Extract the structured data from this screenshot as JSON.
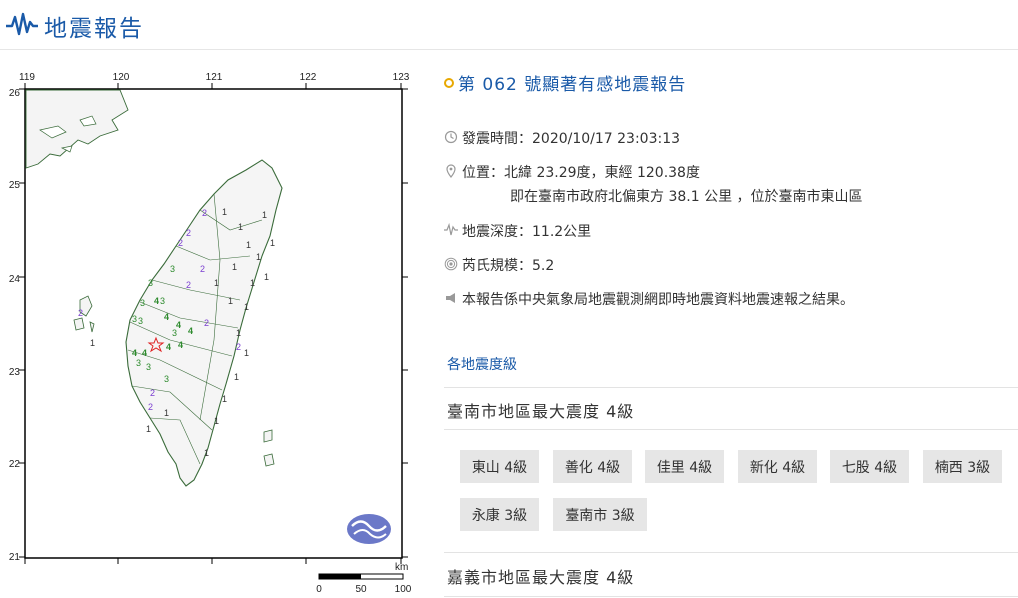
{
  "header": {
    "title": "地震報告",
    "icon": "seismic-wave-icon",
    "accent": "#1a5aa8"
  },
  "map": {
    "lon_ticks": [
      "119",
      "120",
      "121",
      "122",
      "123"
    ],
    "lat_ticks": [
      "26",
      "25",
      "24",
      "23",
      "22",
      "21"
    ],
    "scale_unit": "km",
    "scale_labels": [
      "0",
      "50",
      "100"
    ],
    "epicenter_marker": "star-icon",
    "intensity_labels": {
      "one": "1",
      "two": "2",
      "three": "3",
      "four": "4"
    },
    "island_label": "1",
    "colors": {
      "one": "#333333",
      "two": "#7b3fd0",
      "three": "#2e8b2e",
      "four": "#2e8b2e",
      "star": "#e02020",
      "coast": "#3a6b3a"
    }
  },
  "report": {
    "title": "第 062 號顯著有感地震報告",
    "time_label": "發震時間：2020/10/17 23:03:13",
    "location_label": "位置：北緯 23.29度，東經 120.38度",
    "location_detail": "即在臺南市政府北偏東方 38.1 公里 ，位於臺南市東山區",
    "depth_label": "地震深度：11.2公里",
    "magnitude_label": "芮氏規模：5.2",
    "note": "本報告係中央氣象局地震觀測網即時地震資料地震速報之結果。"
  },
  "intensity": {
    "section_title": "各地震度級",
    "tainan_header": "臺南市地區最大震度 4級",
    "tainan_chips": [
      "東山 4級",
      "善化 4級",
      "佳里 4級",
      "新化 4級",
      "七股 4級",
      "楠西 3級",
      "永康 3級",
      "臺南市 3級"
    ],
    "chiayi_header": "嘉義市地區最大震度 4級"
  }
}
